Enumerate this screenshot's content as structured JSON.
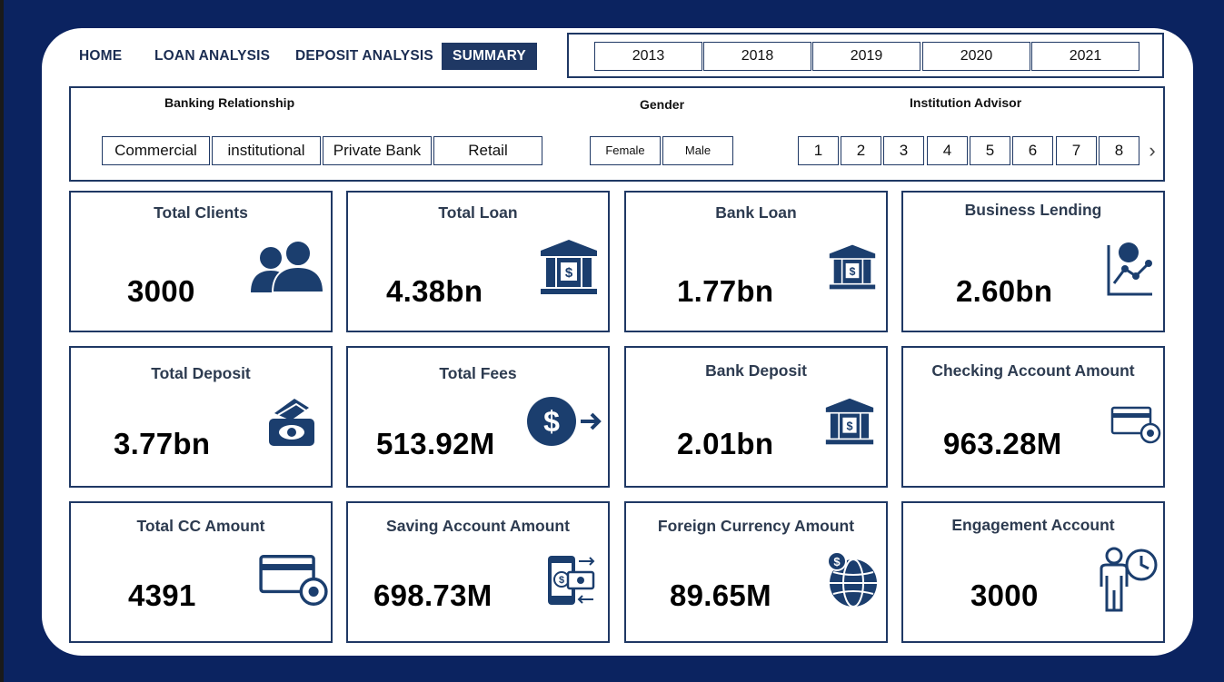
{
  "nav": {
    "items": [
      {
        "label": "HOME",
        "active": false
      },
      {
        "label": "LOAN ANALYSIS",
        "active": false
      },
      {
        "label": "DEPOSIT ANALYSIS",
        "active": false
      },
      {
        "label": "SUMMARY",
        "active": true
      }
    ]
  },
  "years": [
    "2013",
    "2018",
    "2019",
    "2020",
    "2021"
  ],
  "filters": {
    "banking_relationship": {
      "title": "Banking Relationship",
      "options": [
        "Commercial",
        "institutional",
        "Private Bank",
        "Retail"
      ]
    },
    "gender": {
      "title": "Gender",
      "options": [
        "Female",
        "Male"
      ]
    },
    "institution_advisor": {
      "title": "Institution Advisor",
      "options": [
        "1",
        "2",
        "3",
        "4",
        "5",
        "6",
        "7",
        "8"
      ]
    }
  },
  "cards": [
    {
      "title": "Total Clients",
      "value": "3000",
      "icon": "people-icon"
    },
    {
      "title": "Total Loan",
      "value": "4.38bn",
      "icon": "bank-icon"
    },
    {
      "title": "Bank Loan",
      "value": "1.77bn",
      "icon": "bank-icon"
    },
    {
      "title": "Business Lending",
      "value": "2.60bn",
      "icon": "chart-growth-icon"
    },
    {
      "title": "Total Deposit",
      "value": "3.77bn",
      "icon": "cash-icon"
    },
    {
      "title": "Total Fees",
      "value": "513.92M",
      "icon": "dollar-transfer-icon"
    },
    {
      "title": "Bank Deposit",
      "value": "2.01bn",
      "icon": "bank-icon"
    },
    {
      "title": "Checking Account Amount",
      "value": "963.28M",
      "icon": "card-settings-icon"
    },
    {
      "title": "Total CC Amount",
      "value": "4391",
      "icon": "card-settings-icon"
    },
    {
      "title": "Saving Account Amount",
      "value": "698.73M",
      "icon": "mobile-payment-icon"
    },
    {
      "title": "Foreign Currency Amount",
      "value": "89.65M",
      "icon": "globe-dollar-icon"
    },
    {
      "title": "Engagement Account",
      "value": "3000",
      "icon": "person-clock-icon"
    }
  ],
  "colors": {
    "background": "#0b2360",
    "accent": "#1f3864",
    "icon": "#1b3e6e"
  }
}
